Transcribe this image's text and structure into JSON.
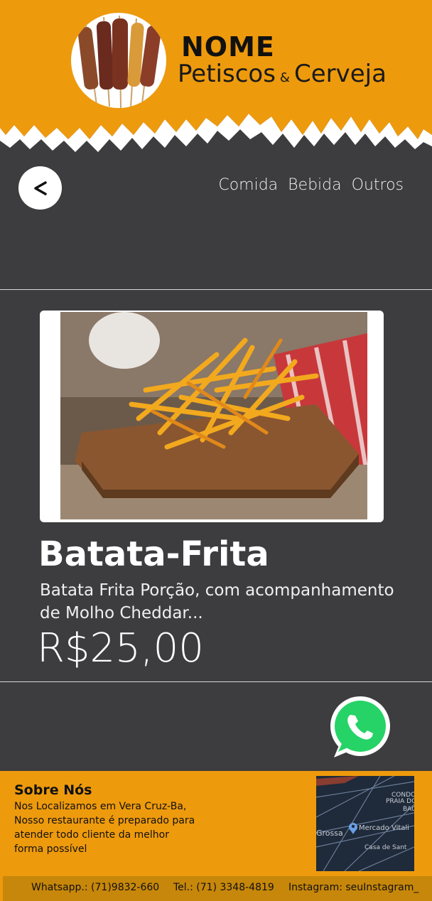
{
  "header": {
    "brand_name": "NOME",
    "brand_sub_1": "Petiscos",
    "brand_amp": "&",
    "brand_sub_2": "Cerveja"
  },
  "nav": {
    "back_label": "<",
    "items": [
      "Comida",
      "Bebida",
      "Outros"
    ]
  },
  "product": {
    "title": "Batata-Frita",
    "description": "Batata Frita Porção, com acompanhamento de Molho Cheddar...",
    "price": "R$25,00"
  },
  "footer": {
    "about_title": "Sobre Nós",
    "about_text": "Nos Localizamos em Vera Cruz-Ba, Nosso restaurante é preparado para atender todo cliente da melhor forma possível",
    "map_labels": [
      "CONDO",
      "PRAIA DO",
      "BAC",
      "Grossa",
      "Mercado Vitali",
      "Casa de Sant"
    ],
    "whatsapp": "Whatsapp.: (71)9832-660",
    "tel": "Tel.: (71) 3348-4819",
    "instagram": "Instagram: seuInstagram_"
  },
  "colors": {
    "accent": "#ee9a0d",
    "background": "#3d3c3e",
    "whatsapp": "#25d366"
  },
  "icons": {
    "back": "chevron-left-icon",
    "whatsapp": "whatsapp-icon",
    "map_pin": "map-pin-icon"
  }
}
